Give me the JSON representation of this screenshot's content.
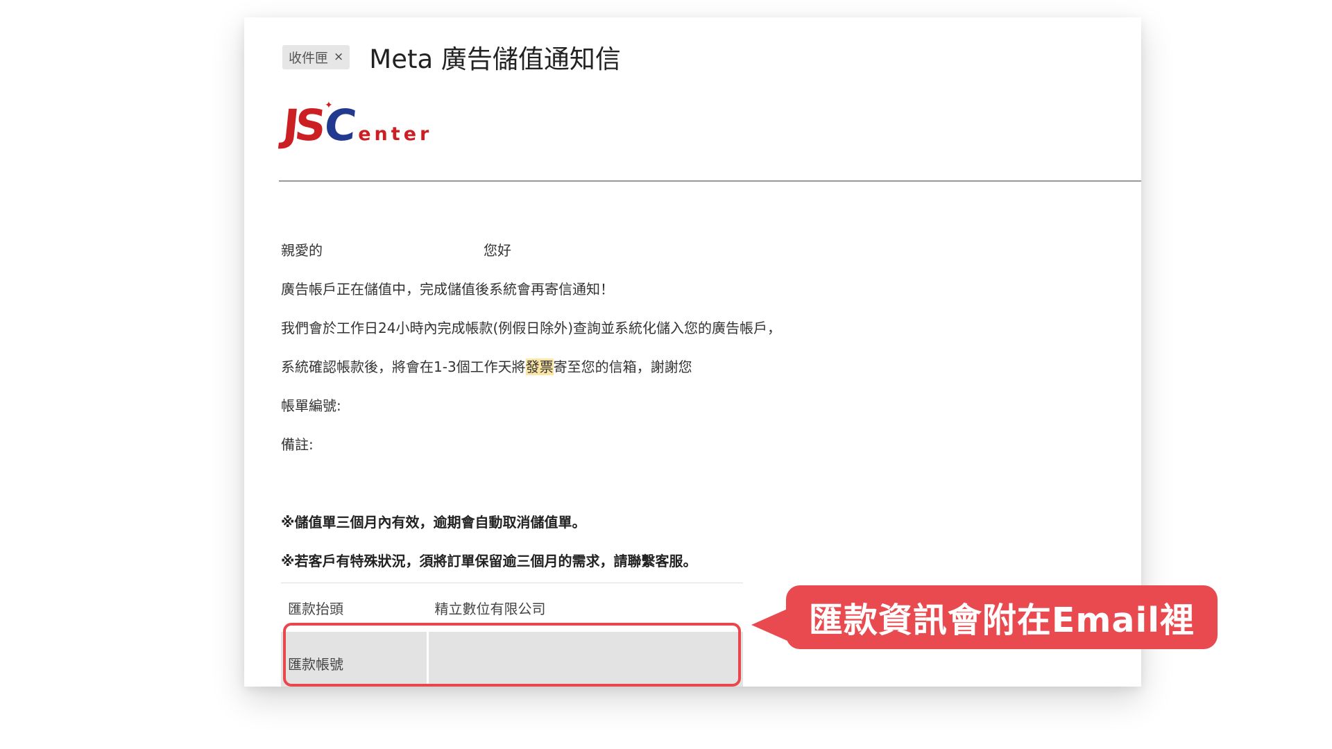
{
  "email": {
    "label_chip": "收件匣",
    "label_chip_close": "×",
    "subject": "Meta 廣告儲值通知信",
    "logo": {
      "part1": "JS",
      "part2": "C",
      "part3": "enter"
    },
    "greeting_prefix": "親愛的",
    "greeting_suffix": "您好",
    "lines": [
      "廣告帳戶正在儲值中，完成儲值後系統會再寄信通知！",
      "我們會於工作日24小時內完成帳款(例假日除外)查詢並系統化儲入您的廣告帳戶，"
    ],
    "line3_before": "系統確認帳款後，將會在1-3個工作天將",
    "line3_highlight": "發票",
    "line3_after": "寄至您的信箱，謝謝您",
    "order_no_label": "帳單編號:",
    "note_label": "備註:",
    "notices": [
      "※儲值單三個月內有效，逾期會自動取消儲值單。",
      "※若客戶有特殊狀況，須將訂單保留逾三個月的需求，請聯繫客服。"
    ],
    "bank_table": {
      "payee_label": "匯款抬頭",
      "payee_value": "精立數位有限公司",
      "account_label": "匯款帳號",
      "account_value": ""
    }
  },
  "callout": {
    "text": "匯款資訊會附在Email裡",
    "color": "#e84a4f"
  }
}
